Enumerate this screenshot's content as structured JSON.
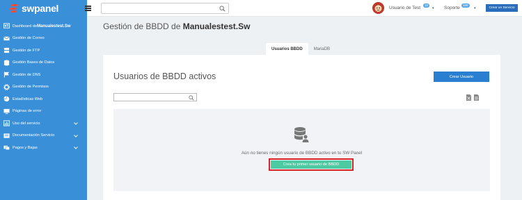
{
  "brand": {
    "name": "swpanel",
    "accent": "#3a8fd9",
    "logo_color": "#ef4f3c"
  },
  "sidebar": {
    "items": [
      {
        "label": "Dashboard de ",
        "bold": "Manualestest.Sw",
        "icon": "dashboard-icon"
      },
      {
        "label": "Gestión de Correo",
        "icon": "mail-icon"
      },
      {
        "label": "Gestión de FTP",
        "icon": "server-icon"
      },
      {
        "label": "Gestión Bases de Datos",
        "icon": "database-icon"
      },
      {
        "label": "Gestión de DNS",
        "icon": "flag-icon"
      },
      {
        "label": "Gestión de Permisos",
        "icon": "gear-icon"
      },
      {
        "label": "Estadísticas Web",
        "icon": "pie-chart-icon"
      },
      {
        "label": "Páginas de error",
        "icon": "monitor-icon"
      },
      {
        "label": "Uso del servicio",
        "icon": "usage-icon",
        "expandable": true
      },
      {
        "label": "Documentación Servicio",
        "icon": "document-icon",
        "expandable": true
      },
      {
        "label": "Pagos y Bajas",
        "icon": "payments-icon",
        "expandable": true
      }
    ]
  },
  "topbar": {
    "search_placeholder": "",
    "user_label": "Usuario de Test",
    "user_badge": "10",
    "support_label": "Soporte",
    "support_badge": "100",
    "create_service_label": "Crear un Servicio"
  },
  "main": {
    "title_prefix": "Gestión de BBDD de ",
    "title_domain": "Manualestest.Sw",
    "tabs": [
      {
        "label": "Usuarios BBDD",
        "active": true
      },
      {
        "label": "MariaDB",
        "active": false
      }
    ],
    "panel_title": "Usuarios de BBDD activos",
    "create_user_label": "Crear Usuario",
    "search_placeholder": "",
    "empty_message": "Aún no tienes ningún usuario de BBDD activo en tu SW Panel",
    "cta_label": "Crea tu primer usuario de BBDD",
    "cta_color": "#4ecaa3",
    "highlight_color": "#d6242a"
  }
}
